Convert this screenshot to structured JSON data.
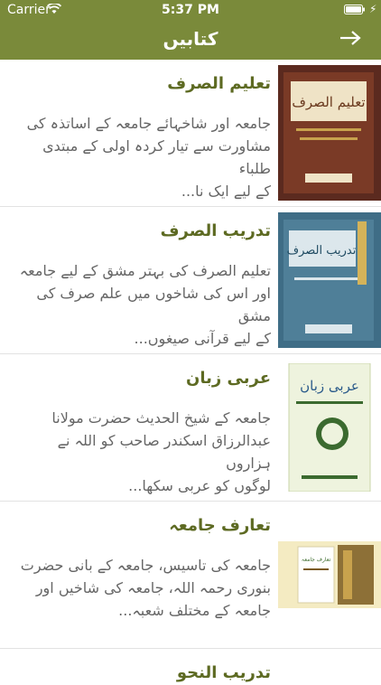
{
  "status": {
    "carrier": "Carrier",
    "time": "5:37 PM"
  },
  "nav": {
    "title": "کتابیں",
    "back_icon": "arrow-right-icon"
  },
  "books": [
    {
      "title": "تعلیم الصرف",
      "desc_lines": [
        "جامعہ اور شاخہائے جامعہ کے اساتذہ کی",
        "مشاورت سے تیار کردہ اولی کے مبتدی طلباء",
        "کے لیے ایک نا..."
      ],
      "cover": {
        "word": "تعلیم الصرف",
        "bg": "#5b2a1f",
        "accent": "#c8a24d"
      }
    },
    {
      "title": "تدریب الصرف",
      "desc_lines": [
        "تعلیم الصرف کی بہتر مشق کے لیے جامعہ",
        "اور اس کی شاخوں میں علم صرف کی مشق",
        "کے لیے قرآنی صیغوں..."
      ],
      "cover": {
        "word": "تدریب الصرف",
        "bg": "#3f6d86",
        "accent": "#d4b35a"
      }
    },
    {
      "title": "عربی زبان",
      "desc_lines": [
        "جامعہ کے شیخ الحدیث حضرت مولانا",
        "عبدالرزاق اسکندر صاحب کو اللہ نے ہزاروں",
        "لوگوں کو عربی سکھا..."
      ],
      "cover": {
        "word": "عربی زبان",
        "bg": "#eef3de",
        "accent": "#3b6a2f"
      }
    },
    {
      "title": "تعارف جامعہ",
      "desc_lines": [
        "جامعہ کی تاسیس، جامعہ کے بانی حضرت",
        "بنوری رحمہ اللہ، جامعہ کی شاخیں اور",
        "جامعہ کے مختلف شعبہ..."
      ],
      "cover": {
        "word": "تعارف جامعہ",
        "bg": "#f4ebc2",
        "accent": "#7a5a1e"
      }
    },
    {
      "title": "تدریب النحو",
      "desc_lines": [],
      "cover": {
        "word": "",
        "bg": "#ffffff",
        "accent": "#ffffff"
      }
    }
  ]
}
